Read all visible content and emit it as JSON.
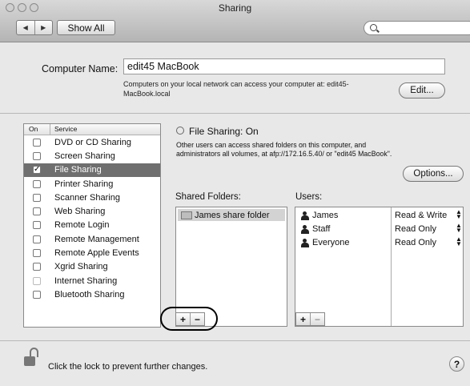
{
  "window": {
    "title": "Sharing"
  },
  "toolbar": {
    "show_all_label": "Show All",
    "back_glyph": "◀",
    "forward_glyph": "▶"
  },
  "computer": {
    "name_label": "Computer Name:",
    "name_value": "edit45 MacBook",
    "description": "Computers on your local network can access your computer at: edit45-MacBook.local",
    "edit_label": "Edit..."
  },
  "services": {
    "header_on": "On",
    "header_service": "Service",
    "items": [
      {
        "label": "DVD or CD Sharing",
        "checked": false
      },
      {
        "label": "Screen Sharing",
        "checked": false
      },
      {
        "label": "File Sharing",
        "checked": true,
        "selected": true
      },
      {
        "label": "Printer Sharing",
        "checked": false
      },
      {
        "label": "Scanner Sharing",
        "checked": false
      },
      {
        "label": "Web Sharing",
        "checked": false
      },
      {
        "label": "Remote Login",
        "checked": false
      },
      {
        "label": "Remote Management",
        "checked": false
      },
      {
        "label": "Remote Apple Events",
        "checked": false
      },
      {
        "label": "Xgrid Sharing",
        "checked": false
      },
      {
        "label": "Internet Sharing",
        "checked": false,
        "disabled": true
      },
      {
        "label": "Bluetooth Sharing",
        "checked": false
      }
    ]
  },
  "file_sharing": {
    "status": "File Sharing: On",
    "description": "Other users can access shared folders on this computer, and administrators all volumes, at afp://172.16.5.40/ or \"edit45 MacBook\".",
    "options_label": "Options...",
    "shared_folders_label": "Shared Folders:",
    "users_label": "Users:",
    "folders": [
      "James share folder"
    ],
    "users": [
      {
        "name": "James",
        "permission": "Read & Write"
      },
      {
        "name": "Staff",
        "permission": "Read Only"
      },
      {
        "name": "Everyone",
        "permission": "Read Only"
      }
    ],
    "plus": "+",
    "minus": "−"
  },
  "footer": {
    "lock_text": "Click the lock to prevent further changes.",
    "help": "?"
  }
}
